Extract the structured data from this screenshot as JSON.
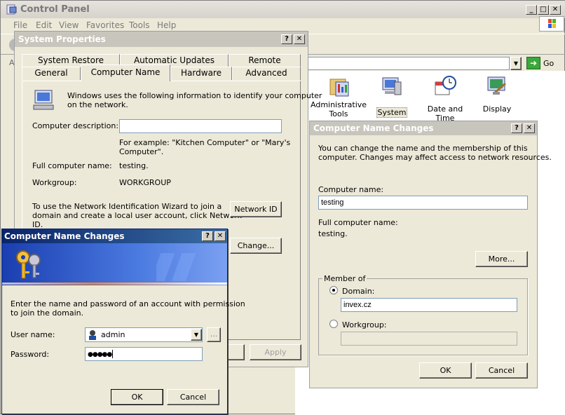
{
  "control_panel": {
    "title": "Control Panel",
    "menu": [
      "File",
      "Edit",
      "View",
      "Favorites",
      "Tools",
      "Help"
    ],
    "address_prefix": "A",
    "go_label": "Go",
    "icons": [
      {
        "label_line1": "Administrative",
        "label_line2": "Tools",
        "icon": "admin-tools-icon"
      },
      {
        "label_line1": "System",
        "label_line2": "",
        "icon": "system-icon"
      },
      {
        "label_line1": "Date and Time",
        "label_line2": "",
        "icon": "date-time-icon"
      },
      {
        "label_line1": "Display",
        "label_line2": "",
        "icon": "display-icon"
      }
    ]
  },
  "system_properties": {
    "title": "System Properties",
    "tabs_row1": [
      "System Restore",
      "Automatic Updates",
      "Remote"
    ],
    "tabs_row2": [
      "General",
      "Computer Name",
      "Hardware",
      "Advanced"
    ],
    "active_tab": "Computer Name",
    "intro_line1": "Windows uses the following information to identify your computer",
    "intro_line2": "on the network.",
    "computer_description_label": "Computer description:",
    "computer_description_value": "",
    "example_line1": "For example: \"Kitchen Computer\" or \"Mary's",
    "example_line2": "Computer\".",
    "full_name_label": "Full computer name:",
    "full_name_value": "testing.",
    "workgroup_label": "Workgroup:",
    "workgroup_value": "WORKGROUP",
    "wizard_line1": "To use the Network Identification Wizard to join a",
    "wizard_line2": "domain and create a local user account, click Network",
    "wizard_line3": "ID.",
    "network_id_label": "Network ID",
    "change_label": "Change...",
    "apply_label": "Apply"
  },
  "cnc_right": {
    "title": "Computer Name Changes",
    "intro_line1": "You can change the name and the membership of this",
    "intro_line2": "computer. Changes may affect access to network resources.",
    "computer_name_label": "Computer name:",
    "computer_name_value": "testing",
    "full_name_label": "Full computer name:",
    "full_name_value": "testing.",
    "more_label": "More...",
    "member_of_label": "Member of",
    "domain_label": "Domain:",
    "domain_value": "invex.cz",
    "workgroup_label": "Workgroup:",
    "workgroup_value": "",
    "ok_label": "OK",
    "cancel_label": "Cancel"
  },
  "cnc_left": {
    "title": "Computer Name Changes",
    "intro_line1": "Enter the name and password of an account with permission",
    "intro_line2": "to join the domain.",
    "username_label": "User name:",
    "username_value": "admin",
    "browse_label": "...",
    "password_label": "Password:",
    "password_value": "●●●●●",
    "ok_label": "OK",
    "cancel_label": "Cancel"
  }
}
